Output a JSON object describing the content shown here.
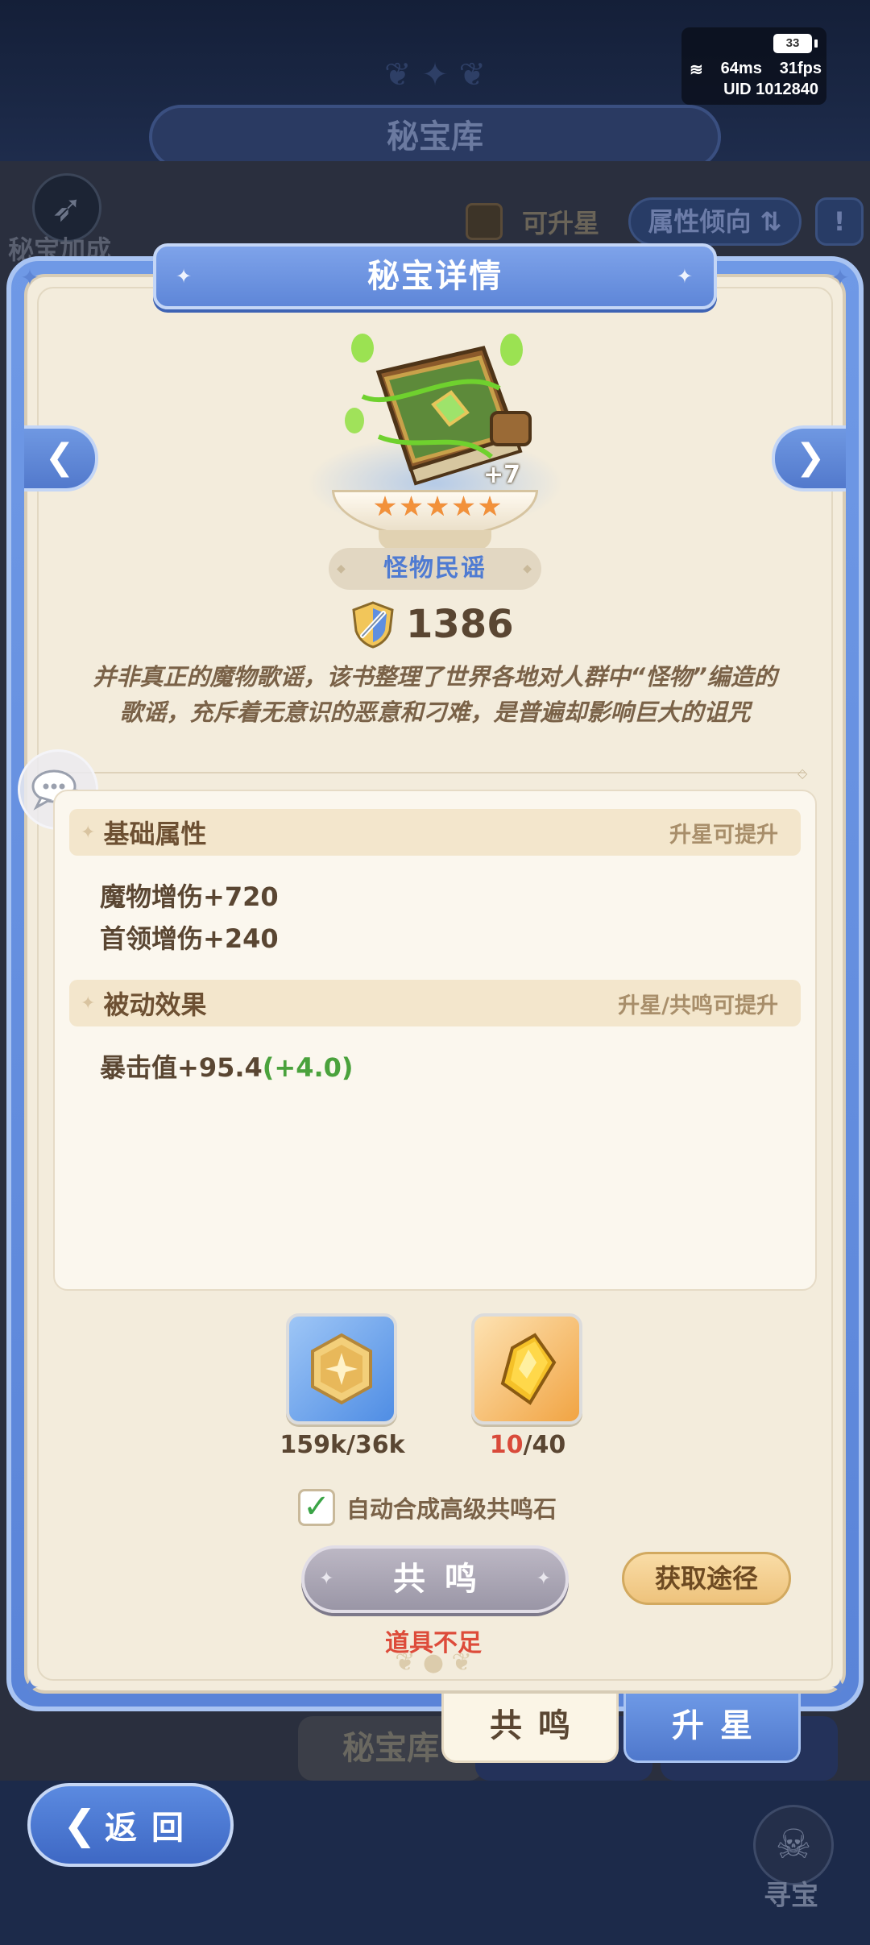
{
  "status": {
    "battery": "33",
    "ping": "64ms",
    "fps": "31fps",
    "uid": "UID 1012840"
  },
  "background": {
    "screen_title": "秘宝库",
    "left_label": "秘宝加成",
    "upstar_filter_label": "可升星",
    "attr_tendency_label": "属性倾向",
    "tab_treasury": "秘宝库",
    "treasure_hunt_label": "寻宝",
    "back_label": "返回"
  },
  "dialog": {
    "title": "秘宝详情",
    "item": {
      "plus_level": "+7",
      "stars": 5,
      "name": "怪物民谣",
      "power": "1386",
      "description": "并非真正的魔物歌谣，该书整理了世界各地对人群中“怪物”编造的歌谣，充斥着无意识的恶意和刁难，是普遍却影响巨大的诅咒"
    },
    "basic_section": {
      "title": "基础属性",
      "hint": "升星可提升",
      "stats": [
        "魔物增伤+720",
        "首领增伤+240"
      ]
    },
    "passive_section": {
      "title": "被动效果",
      "hint": "升星/共鸣可提升",
      "stat_base": "暴击值+95.4",
      "stat_bonus": "(+4.0)"
    },
    "materials": [
      {
        "icon": "gold-coin-icon",
        "have": "159k",
        "sep": "/",
        "need": "36k"
      },
      {
        "icon": "amber-crystal-icon",
        "have": "10",
        "sep": "/",
        "need": "40"
      }
    ],
    "auto_merge_label": "自动合成高级共鸣石",
    "auto_merge_checked": true,
    "resonate_button": "共鸣",
    "get_source_button": "获取途径",
    "insufficient_text": "道具不足",
    "tabs": [
      "共鸣",
      "升星"
    ]
  },
  "colors": {
    "accent_blue": "#5e86d8",
    "panel_cream": "#f3ecdc",
    "warning_red": "#dd4b3a",
    "bonus_green": "#4aa23c"
  }
}
